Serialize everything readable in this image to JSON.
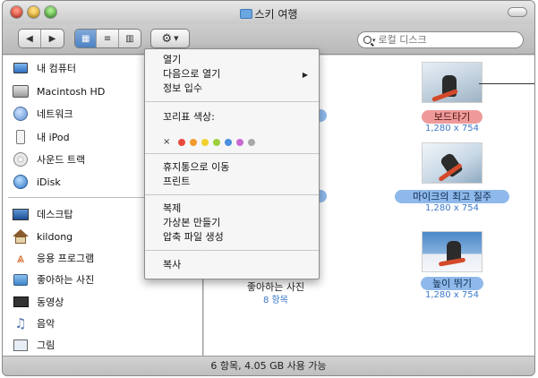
{
  "window": {
    "title": "스키 여행"
  },
  "search": {
    "placeholder": "로컬 디스크"
  },
  "sidebar": {
    "devices": [
      {
        "label": "내 컴퓨터",
        "icon": "computer-icon"
      },
      {
        "label": "Macintosh HD",
        "icon": "hard-drive-icon"
      },
      {
        "label": "네트워크",
        "icon": "network-globe-icon"
      },
      {
        "label": "내 iPod",
        "icon": "ipod-icon"
      },
      {
        "label": "사운드 트랙",
        "icon": "cd-icon"
      },
      {
        "label": "iDisk",
        "icon": "idisk-icon"
      }
    ],
    "places": [
      {
        "label": "데스크탑",
        "icon": "desktop-icon"
      },
      {
        "label": "kildong",
        "icon": "home-icon"
      },
      {
        "label": "응용 프로그램",
        "icon": "applications-icon"
      },
      {
        "label": "좋아하는 사진",
        "icon": "pictures-folder-icon"
      },
      {
        "label": "동영상",
        "icon": "movies-icon"
      },
      {
        "label": "음악",
        "icon": "music-icon"
      },
      {
        "label": "그림",
        "icon": "picture-frame-icon"
      }
    ]
  },
  "context_menu": {
    "items": [
      {
        "label": "열기"
      },
      {
        "label": "다음으로 열기",
        "submenu": "▶"
      },
      {
        "label": "정보 입수"
      },
      {
        "label": "꼬리표 색상:"
      },
      {
        "label": "휴지통으로 이동"
      },
      {
        "label": "프린트"
      },
      {
        "label": "복제"
      },
      {
        "label": "가상본 만들기"
      },
      {
        "label": "압축 파일 생성"
      },
      {
        "label": "복사"
      }
    ],
    "label_colors": {
      "clear_symbol": "×",
      "swatches": [
        "#e84a3e",
        "#f29a2e",
        "#f2d12e",
        "#9ccf3a",
        "#4a8fe0",
        "#c66ad1",
        "#a8a8a8"
      ]
    }
  },
  "files": [
    {
      "name": "보드타기",
      "size": "1,280 x 754",
      "label_color": "#ef9a9a"
    },
    {
      "name": "마이크의 최고 질주",
      "size": "1,280 x 754",
      "label_color": "#8fb9ea"
    },
    {
      "name": "높이 뛰기",
      "size": "1,280 x 754",
      "label_color": "#8fb9ea"
    }
  ],
  "folder_preview": {
    "name": "좋아하는 사진",
    "count": "8 항목"
  },
  "status_bar": {
    "text": "6 항목, 4.05 GB 사용 가능"
  }
}
